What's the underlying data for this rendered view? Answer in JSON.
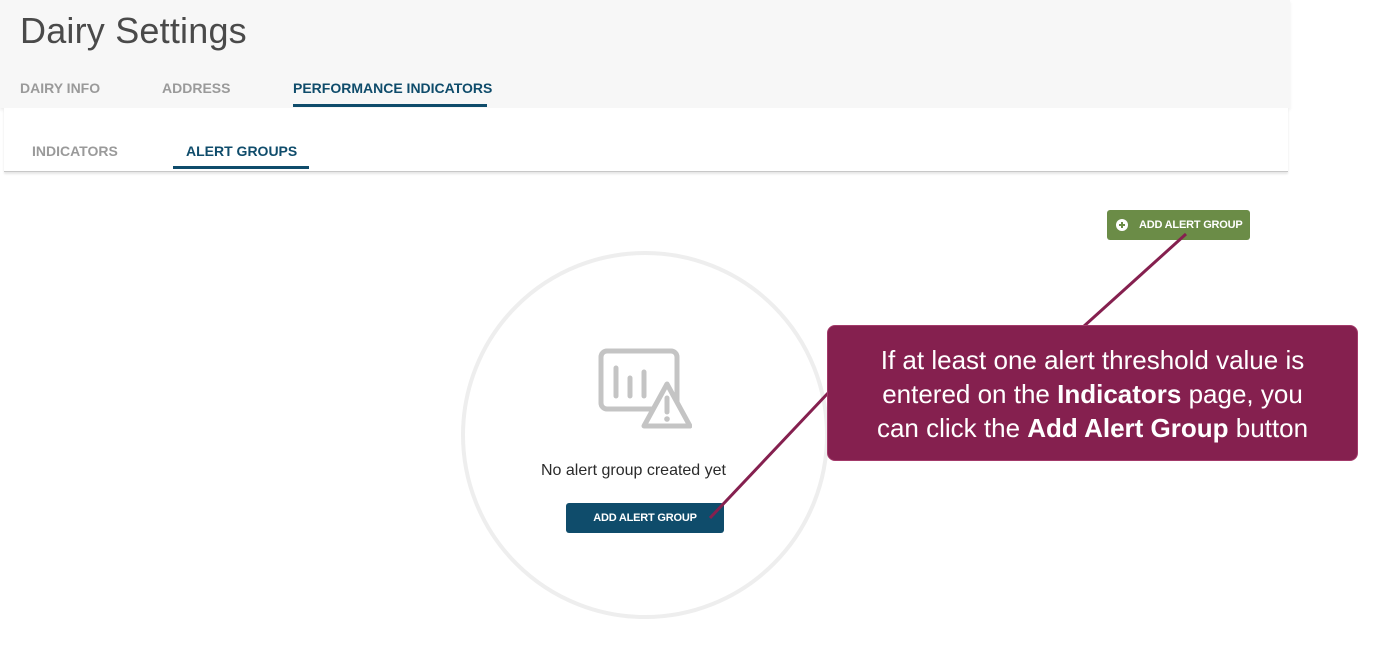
{
  "header": {
    "title": "Dairy Settings",
    "tabs": [
      {
        "label": "DAIRY INFO",
        "active": false
      },
      {
        "label": "ADDRESS",
        "active": false
      },
      {
        "label": "PERFORMANCE INDICATORS",
        "active": true
      }
    ]
  },
  "subtabs": [
    {
      "label": "INDICATORS",
      "active": false
    },
    {
      "label": "ALERT GROUPS",
      "active": true
    }
  ],
  "toolbar": {
    "add_alert_group_label": "ADD ALERT GROUP",
    "add_icon": "plus-circle-icon"
  },
  "empty_state": {
    "icon": "chart-warning-icon",
    "message": "No alert group created yet",
    "button_label": "ADD ALERT GROUP"
  },
  "callout": {
    "line1": "If at least one alert threshold value is",
    "line2_pre": "entered on the ",
    "line2_bold": "Indicators",
    "line2_post": " page, you",
    "line3_pre": "can click the ",
    "line3_bold": "Add Alert Group",
    "line3_post": " button"
  },
  "colors": {
    "primary": "#0f4c6b",
    "add_button": "#6b8c47",
    "callout": "#85204f",
    "tab_inactive": "#9a9a9a"
  }
}
